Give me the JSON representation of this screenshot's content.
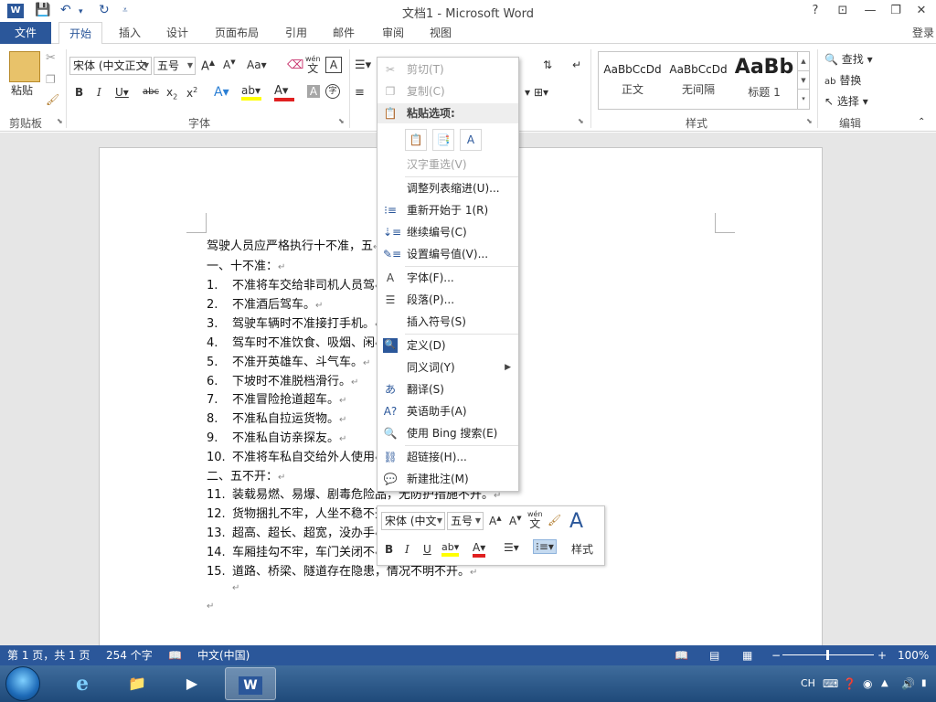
{
  "window": {
    "title": "文档1 - Microsoft Word",
    "help": "?",
    "login": "登录"
  },
  "tabs": [
    {
      "label": "文件"
    },
    {
      "label": "开始"
    },
    {
      "label": "插入"
    },
    {
      "label": "设计"
    },
    {
      "label": "页面布局"
    },
    {
      "label": "引用"
    },
    {
      "label": "邮件"
    },
    {
      "label": "审阅"
    },
    {
      "label": "视图"
    }
  ],
  "ribbon": {
    "clipboard": {
      "paste_label": "粘贴",
      "group_label": "剪贴板"
    },
    "font": {
      "font_name": "宋体 (中文正文",
      "font_size": "五号",
      "group_label": "字体",
      "wen": "wén",
      "wen_char": "文"
    },
    "styles": {
      "group_label": "样式",
      "items": [
        {
          "sample": "AaBbCcDd",
          "name": "正文"
        },
        {
          "sample": "AaBbCcDd",
          "name": "无间隔"
        },
        {
          "sample": "AaBb",
          "name": "标题 1"
        }
      ]
    },
    "editing": {
      "find": "查找",
      "replace": "替换",
      "select": "选择",
      "group_label": "编辑"
    }
  },
  "document": {
    "lines": [
      {
        "num": "",
        "text": "驾驶人员应严格执行十不准，五"
      },
      {
        "num": "",
        "text": "一、十不准："
      },
      {
        "num": "1.",
        "text": "不准将车交给非司机人员驾"
      },
      {
        "num": "2.",
        "text": "不准酒后驾车。"
      },
      {
        "num": "3.",
        "text": "驾驶车辆时不准接打手机。"
      },
      {
        "num": "4.",
        "text": "驾车时不准饮食、吸烟、闲"
      },
      {
        "num": "5.",
        "text": "不准开英雄车、斗气车。"
      },
      {
        "num": "6.",
        "text": "下坡时不准脱档滑行。"
      },
      {
        "num": "7.",
        "text": "不准冒险抢道超车。"
      },
      {
        "num": "8.",
        "text": "不准私自拉运货物。"
      },
      {
        "num": "9.",
        "text": "不准私自访亲探友。"
      },
      {
        "num": "10.",
        "text": "不准将车私自交给外人使用"
      },
      {
        "num": "",
        "text": "二、五不开："
      },
      {
        "num": "11.",
        "text": "装载易燃、易爆、剧毒危险品，无防护措施不开。"
      },
      {
        "num": "12.",
        "text": "货物捆扎不牢，人坐不稳不开。"
      },
      {
        "num": "13.",
        "text": "超高、超长、超宽，没办手"
      },
      {
        "num": "14.",
        "text": "车厢挂勾不牢，车门关闭不"
      },
      {
        "num": "15.",
        "text": "道路、桥梁、隧道存在隐患，情况不明不开。"
      },
      {
        "num": "",
        "text": ""
      },
      {
        "num": "",
        "text": ""
      }
    ]
  },
  "context_menu": {
    "items": [
      {
        "label": "剪切(T)",
        "icon": "scissors-icon",
        "disabled": true
      },
      {
        "label": "复制(C)",
        "icon": "copy-icon",
        "disabled": true
      },
      {
        "label": "粘贴选项:",
        "icon": "paste-icon",
        "header": true
      },
      {
        "label": "汉字重选(V)",
        "icon": "",
        "disabled": true
      },
      {
        "label": "调整列表缩进(U)...",
        "icon": ""
      },
      {
        "label": "重新开始于 1(R)",
        "icon": "restart-numbering-icon"
      },
      {
        "label": "继续编号(C)",
        "icon": "continue-numbering-icon"
      },
      {
        "label": "设置编号值(V)...",
        "icon": "set-numbering-value-icon"
      },
      {
        "label": "字体(F)...",
        "icon": "font-icon"
      },
      {
        "label": "段落(P)...",
        "icon": "paragraph-icon"
      },
      {
        "label": "插入符号(S)",
        "icon": ""
      },
      {
        "label": "定义(D)",
        "icon": "define-icon"
      },
      {
        "label": "同义词(Y)",
        "icon": "",
        "submenu": true
      },
      {
        "label": "翻译(S)",
        "icon": "translate-icon"
      },
      {
        "label": "英语助手(A)",
        "icon": "english-assistant-icon"
      },
      {
        "label": "使用 Bing 搜索(E)",
        "icon": "bing-search-icon"
      },
      {
        "label": "超链接(H)...",
        "icon": "hyperlink-icon"
      },
      {
        "label": "新建批注(M)",
        "icon": "new-comment-icon"
      }
    ]
  },
  "mini_toolbar": {
    "font_name": "宋体 (中文",
    "font_size": "五号",
    "styles_label": "样式",
    "wen": "wén",
    "wen_char": "文"
  },
  "statusbar": {
    "page": "第 1 页，共 1 页",
    "words": "254 个字",
    "language": "中文(中国)",
    "zoom": "100%"
  },
  "taskbar": {
    "tray_lang": "CH"
  },
  "colors": {
    "accent": "#2b579a"
  }
}
